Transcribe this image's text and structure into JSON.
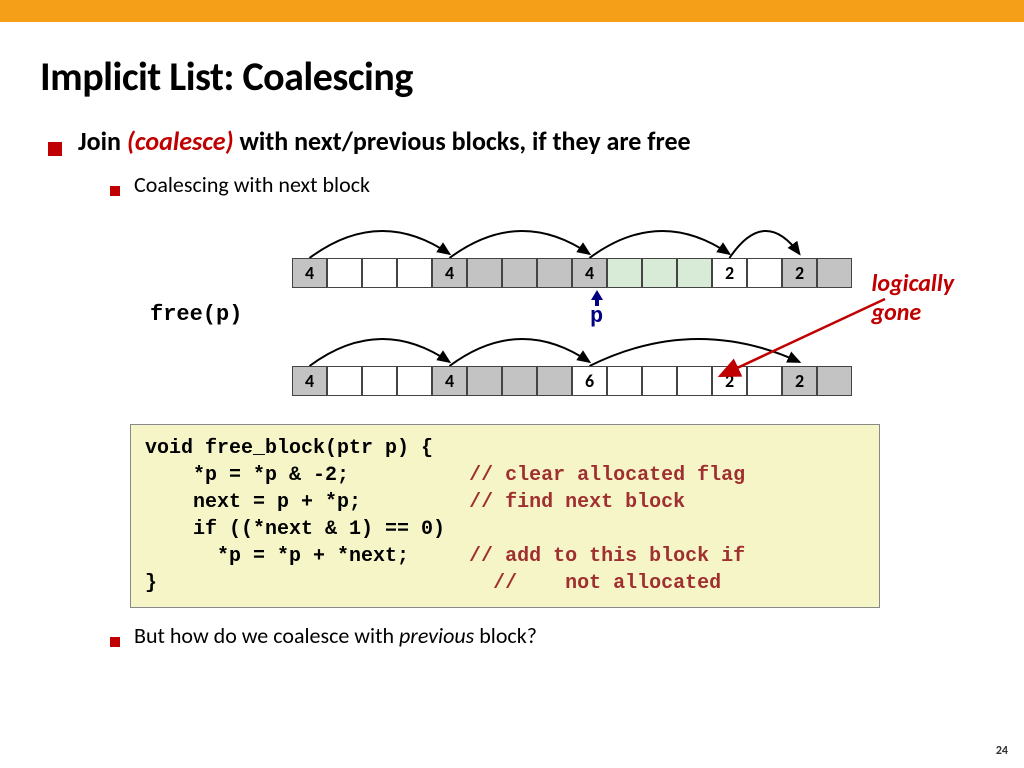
{
  "title": "Implicit List: Coalescing",
  "bullet": {
    "prefix": "Join ",
    "italic": "(coalesce)",
    "suffix": " with next/previous blocks, if they are free"
  },
  "sub1": "Coalescing with next block",
  "sub2_prefix": "But how do we coalesce with ",
  "sub2_italic": "previous",
  "sub2_suffix": " block?",
  "free_label": "free(p)",
  "p_label": "p",
  "annotation_line1": "logically",
  "annotation_line2": "gone",
  "row1": [
    "4",
    "",
    "",
    "",
    "4",
    "",
    "",
    "",
    "4",
    "",
    "",
    "",
    "2",
    "",
    "2",
    ""
  ],
  "row1_colors": [
    "gray",
    "white",
    "white",
    "white",
    "gray",
    "gray",
    "gray",
    "gray",
    "gray",
    "green",
    "green",
    "green",
    "white",
    "white",
    "gray",
    "gray"
  ],
  "row2": [
    "4",
    "",
    "",
    "",
    "4",
    "",
    "",
    "",
    "6",
    "",
    "",
    "",
    "2",
    "",
    "2",
    ""
  ],
  "row2_colors": [
    "gray",
    "white",
    "white",
    "white",
    "gray",
    "gray",
    "gray",
    "gray",
    "white",
    "white",
    "white",
    "white",
    "white",
    "white",
    "gray",
    "gray"
  ],
  "arcs1": [
    {
      "from": 0,
      "to": 4
    },
    {
      "from": 4,
      "to": 8
    },
    {
      "from": 8,
      "to": 12
    },
    {
      "from": 12,
      "to": 14
    }
  ],
  "arcs2": [
    {
      "from": 0,
      "to": 4
    },
    {
      "from": 4,
      "to": 8
    },
    {
      "from": 8,
      "to": 14
    }
  ],
  "code": {
    "l1": "void free_block(ptr p) {",
    "l2a": "    *p = *p & -2;",
    "l2b": "          // clear allocated flag",
    "l3a": "    next = p + *p;",
    "l3b": "         // find next block",
    "l4": "    if ((*next & 1) == 0)",
    "l5a": "      *p = *p + *next;",
    "l5b": "     // add to this block if",
    "l6a": "}",
    "l6b": "                            //    not allocated"
  },
  "page_number": "24"
}
